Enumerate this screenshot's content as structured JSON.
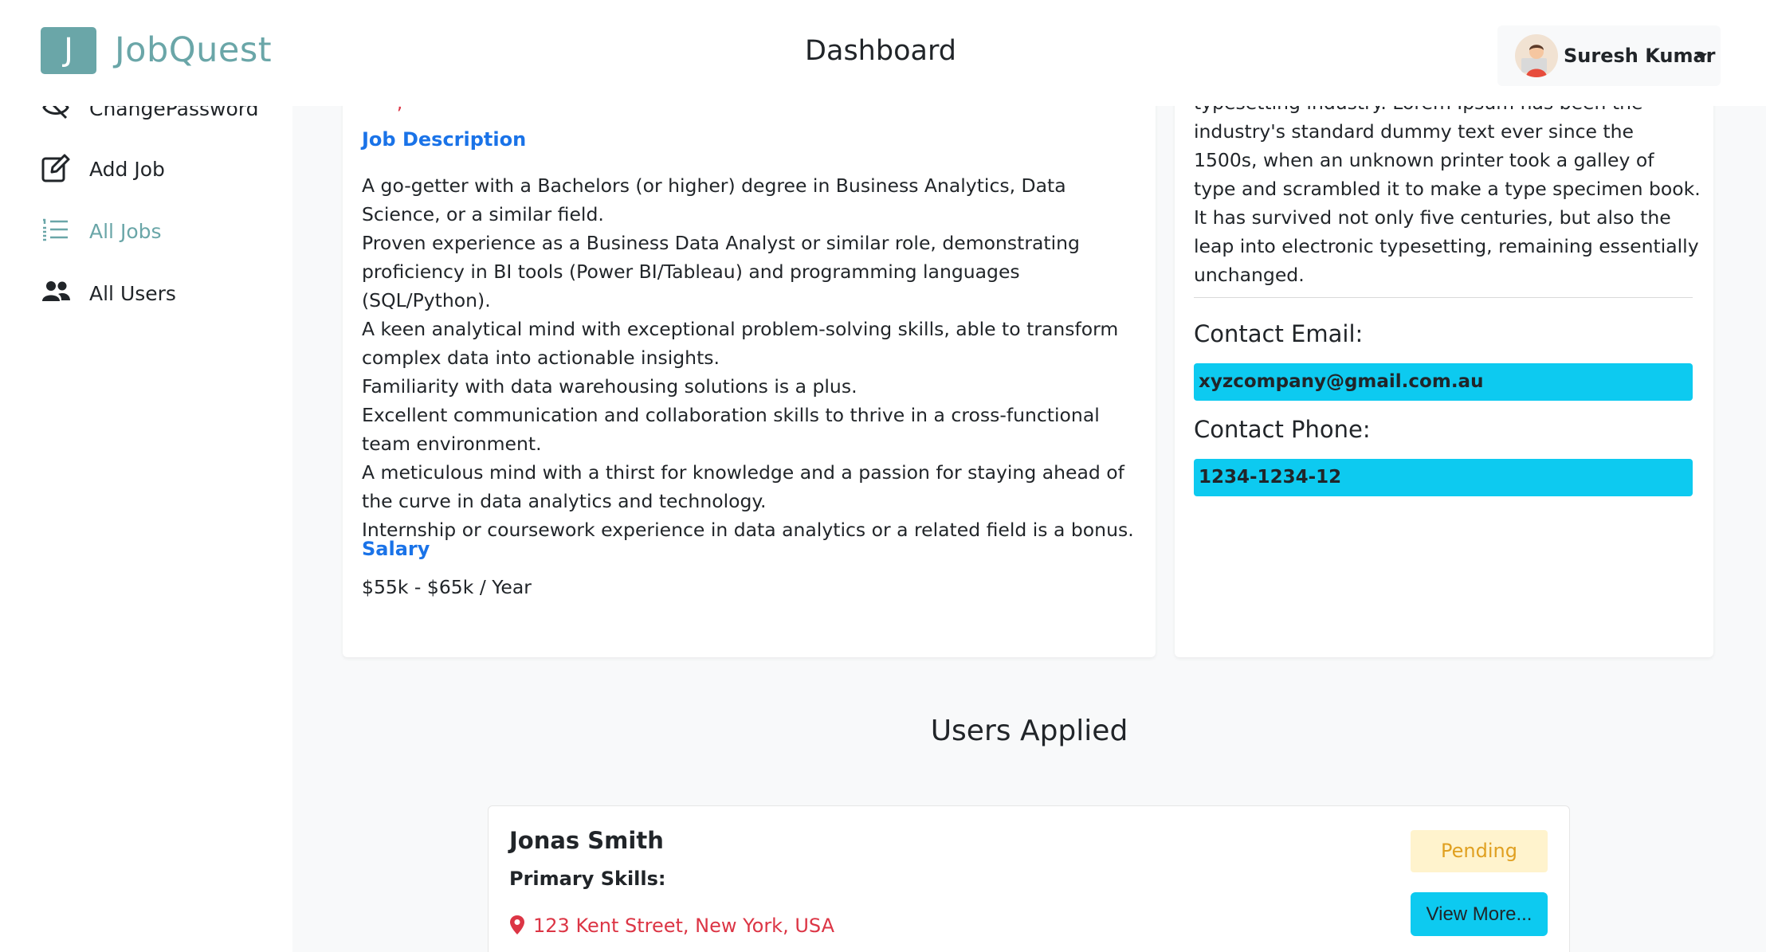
{
  "brand": {
    "logo_letter": "J",
    "name": "JobQuest",
    "color": "#6aa6a8"
  },
  "header": {
    "title": "Dashboard"
  },
  "user": {
    "name": "Suresh Kumar"
  },
  "sidebar": {
    "items": [
      {
        "label": "ChangePassword",
        "icon": "eye-slash-icon"
      },
      {
        "label": "Add Job",
        "icon": "edit-icon"
      },
      {
        "label": "All Jobs",
        "icon": "list-icon",
        "active": true
      },
      {
        "label": "All Users",
        "icon": "users-icon"
      }
    ]
  },
  "job": {
    "description_title": "Job Description",
    "description_lines": [
      "A go-getter with a Bachelors (or higher) degree in Business Analytics, Data Science, or a similar field.",
      "Proven experience as a Business Data Analyst or similar role, demonstrating proficiency in BI tools (Power BI/Tableau) and programming languages (SQL/Python).",
      "A keen analytical mind with exceptional problem-solving skills, able to transform complex data into actionable insights.",
      "Familiarity with data warehousing solutions is a plus.",
      "Excellent communication and collaboration skills to thrive in a cross-functional team environment.",
      "A meticulous mind with a thirst for knowledge and a passion for staying ahead of the curve in data analytics and technology.",
      "Internship or coursework experience in data analytics or a related field is a bonus."
    ],
    "salary_title": "Salary",
    "salary_value": "$55k - $65k / Year"
  },
  "company": {
    "about_text": "typesetting industry. Lorem Ipsum has been the industry's standard dummy text ever since the 1500s, when an unknown printer took a galley of type and scrambled it to make a type specimen book. It has survived not only five centuries, but also the leap into electronic typesetting, remaining essentially unchanged.",
    "email_label": "Contact Email:",
    "email_value": "xyzcompany@gmail.com.au",
    "phone_label": "Contact Phone:",
    "phone_value": "1234-1234-12"
  },
  "applicants": {
    "title": "Users Applied",
    "items": [
      {
        "name": "Jonas Smith",
        "skills_label": "Primary Skills:",
        "location": "123 Kent Street, New York, USA",
        "status": "Pending",
        "action_label": "View More..."
      }
    ]
  }
}
